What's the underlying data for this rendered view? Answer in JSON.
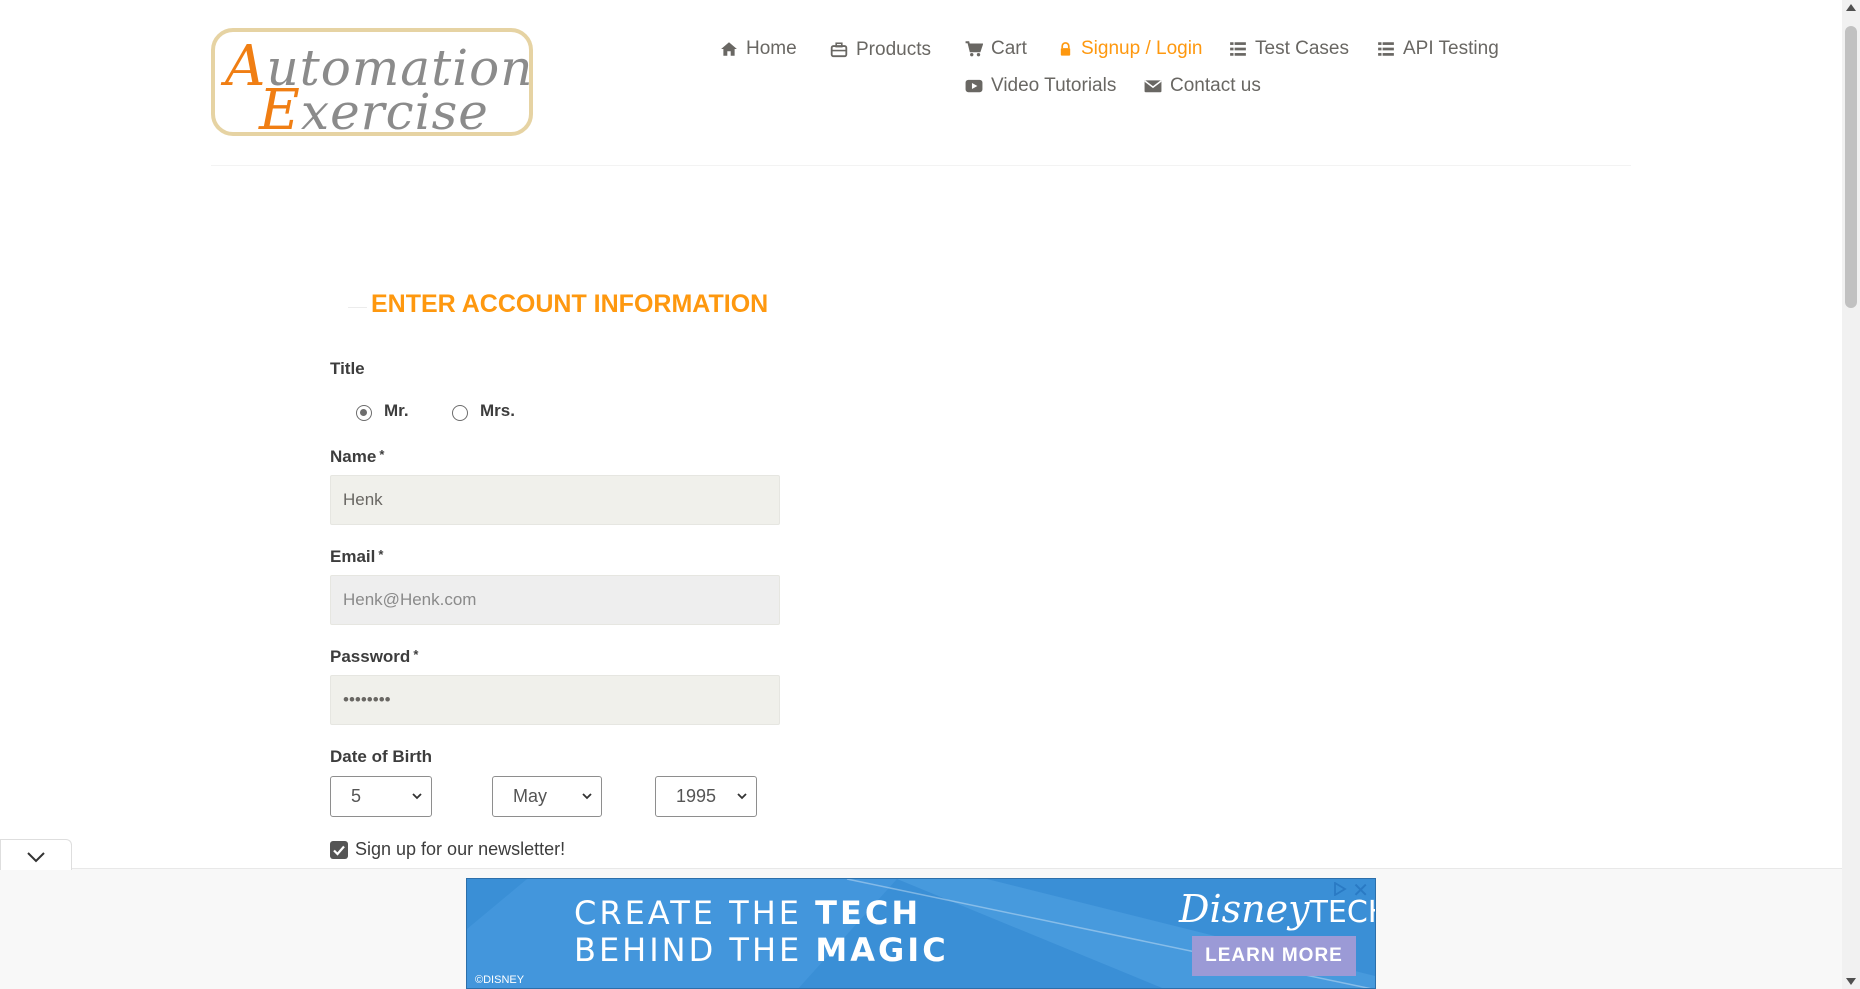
{
  "logo": {
    "line1_cap": "A",
    "line1_rest": "utomation",
    "line2_cap": "E",
    "line2_rest": "xercise"
  },
  "nav": [
    {
      "label": "Home",
      "icon": "home-icon"
    },
    {
      "label": "Products",
      "icon": "briefcase-icon"
    },
    {
      "label": "Cart",
      "icon": "cart-icon"
    },
    {
      "label": "Signup / Login",
      "icon": "lock-icon",
      "active": true
    },
    {
      "label": "Test Cases",
      "icon": "list-icon"
    },
    {
      "label": "API Testing",
      "icon": "list-icon"
    },
    {
      "label": "Video Tutorials",
      "icon": "youtube-play-icon"
    },
    {
      "label": "Contact us",
      "icon": "envelope-icon"
    }
  ],
  "form": {
    "heading": "ENTER ACCOUNT INFORMATION",
    "title_label": "Title",
    "title_options": [
      {
        "label": "Mr.",
        "checked": true
      },
      {
        "label": "Mrs.",
        "checked": false
      }
    ],
    "name_label": "Name",
    "name_value": "Henk",
    "email_label": "Email",
    "email_value": "Henk@Henk.com",
    "password_label": "Password",
    "password_value": "••••••••",
    "required_mark": "*",
    "dob_label": "Date of Birth",
    "dob_day": "5",
    "dob_month": "May",
    "dob_year": "1995",
    "newsletter_label": "Sign up for our newsletter!",
    "newsletter_checked": true
  },
  "ad": {
    "line1_a": "CREATE THE ",
    "line1_b": "TECH",
    "line2_a": "BEHIND THE ",
    "line2_b": "MAGIC",
    "brand_a": "Disney",
    "brand_b": "TECH",
    "cta": "LEARN MORE",
    "copyright": "©DISNEY",
    "close": "✕"
  },
  "colors": {
    "accent": "#fe980f",
    "text": "#696763",
    "input_bg": "#f0f0eb",
    "ad_blue": "#3a8fd6"
  }
}
